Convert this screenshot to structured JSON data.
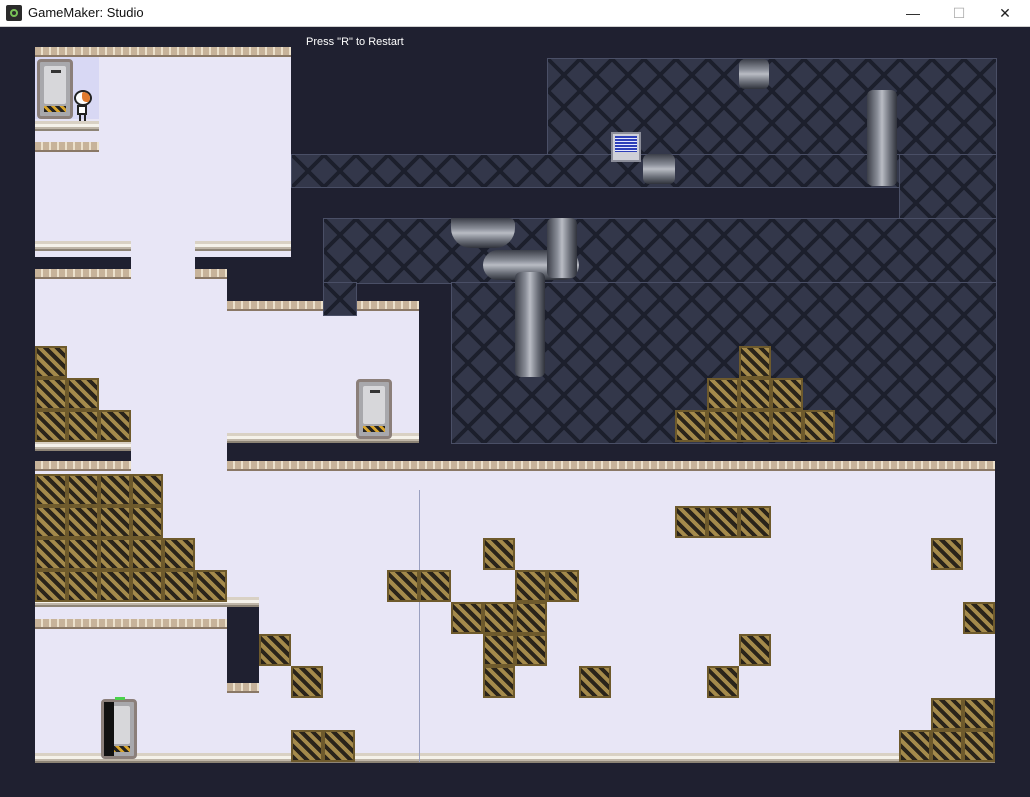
{
  "window": {
    "title": "GameMaker: Studio",
    "minimize_glyph": "—",
    "maximize_glyph": "☐",
    "close_glyph": "✕"
  },
  "hud": {
    "restart_hint": "Press \"R\" to Restart"
  },
  "palette": {
    "background": "#1f2030",
    "room_floor": "#e8e6f6",
    "girder": "#33374a",
    "crate_stripe_dark": "#2a241a",
    "crate_stripe_light": "#a48a4b",
    "player_helmet": "#e07a2e",
    "door_indicator_green": "#4bd14b",
    "monitor_screen": "#2d3fb8"
  },
  "icons": {
    "app": "gamemaker-logo-icon",
    "minimize": "minimize-icon",
    "maximize": "maximize-icon",
    "close": "close-icon"
  }
}
